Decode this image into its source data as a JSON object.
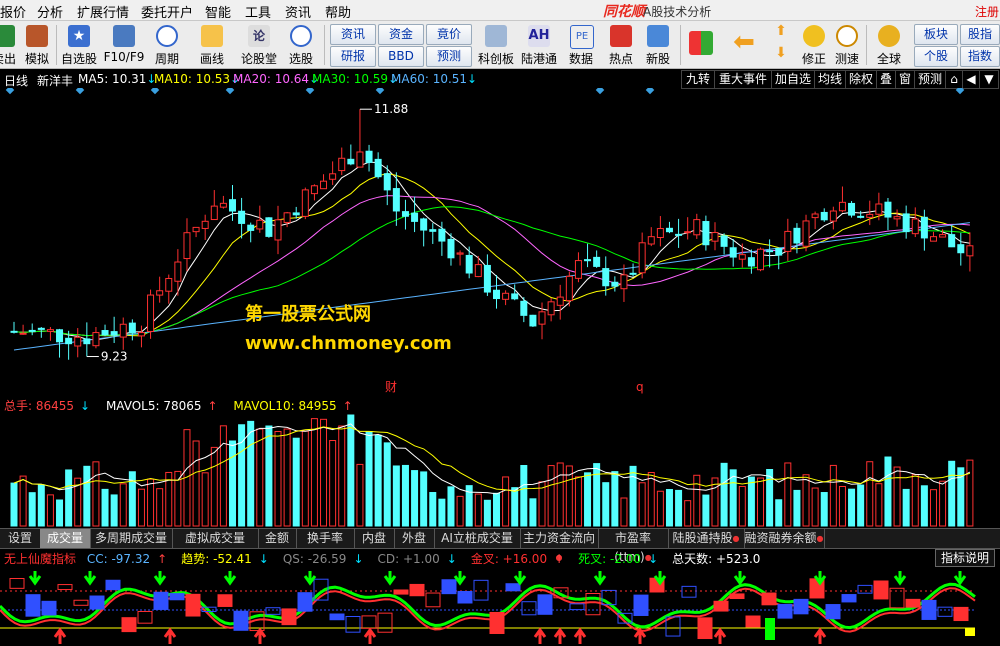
{
  "menu": {
    "items": [
      "报价",
      "分析",
      "扩展行情",
      "委托开户",
      "智能",
      "工具",
      "资讯",
      "帮助"
    ],
    "brand": "同花顺",
    "title": "A股技术分析",
    "register": "注册"
  },
  "toolbar": {
    "buttons": [
      {
        "label": "卖出",
        "icon": "trade-icon"
      },
      {
        "label": "模拟",
        "icon": "hammer-icon"
      },
      {
        "label": "自选股",
        "icon": "star-icon"
      },
      {
        "label": "F10/F9",
        "icon": "document-icon"
      },
      {
        "label": "周期",
        "icon": "clock-icon"
      },
      {
        "label": "画线",
        "icon": "pencil-icon"
      },
      {
        "label": "论股堂",
        "icon": "discuss-icon"
      },
      {
        "label": "选股",
        "icon": "search-icon"
      },
      {
        "label": "科创板",
        "icon": "board-icon"
      },
      {
        "label": "陆港通",
        "icon": "ah-icon"
      },
      {
        "label": "数据",
        "icon": "pe-icon"
      },
      {
        "label": "热点",
        "icon": "hot-icon"
      },
      {
        "label": "新股",
        "icon": "ipo-icon"
      },
      {
        "label": "修正",
        "icon": "gold-icon"
      },
      {
        "label": "测速",
        "icon": "timer-icon"
      },
      {
        "label": "全球",
        "icon": "globe-icon"
      }
    ],
    "ah_text": "AH",
    "pe_text": "PE",
    "small_buttons": [
      "资讯",
      "资金",
      "竟价",
      "研报",
      "BBD",
      "预测",
      "板块",
      "股指",
      "个股",
      "指数"
    ]
  },
  "chart": {
    "period": "日线",
    "stock_name": "新洋丰",
    "ma_items": [
      {
        "text": "MA5: 10.31",
        "arrow": "↓",
        "color": "#ffffff"
      },
      {
        "text": "MA10: 10.53",
        "arrow": "↓",
        "color": "#ffff00"
      },
      {
        "text": "MA20: 10.64",
        "arrow": "↓",
        "color": "#ff66ff"
      },
      {
        "text": "MA30: 10.59",
        "arrow": "↓",
        "color": "#00ff00"
      },
      {
        "text": "MA60: 10.51",
        "arrow": "↓",
        "color": "#5ab4ff"
      }
    ],
    "right_buttons": [
      "九转",
      "重大事件",
      "加自选",
      "均线",
      "除权",
      "叠",
      "窗",
      "预测",
      "⌂",
      "◀",
      "▼"
    ],
    "high_label": "11.88",
    "low_label": "9.23",
    "markers": [
      "财",
      "q"
    ],
    "watermark_line1": "第一股票公式网",
    "watermark_line2": "www.chnmoney.com",
    "colors": {
      "up": "#ff3030",
      "down": "#54ffff",
      "ma5": "#ffffff",
      "ma10": "#ffff00",
      "ma20": "#ff66ff",
      "ma30": "#00ff00",
      "ma60": "#5ab4ff"
    }
  },
  "volume": {
    "label": "总手: 86455",
    "label_arrow": "↓",
    "mavol5": "MAVOL5: 78065",
    "mavol5_arrow": "↑",
    "mavol10": "MAVOL10: 84955",
    "mavol10_arrow": "↑"
  },
  "tabs": [
    {
      "label": "设置",
      "dot": false,
      "active": false
    },
    {
      "label": "成交量",
      "dot": false,
      "active": true
    },
    {
      "label": "多周期成交量",
      "dot": false,
      "active": false
    },
    {
      "label": "虚拟成交量",
      "dot": false,
      "active": false
    },
    {
      "label": "金额",
      "dot": false,
      "active": false
    },
    {
      "label": "换手率",
      "dot": false,
      "active": false
    },
    {
      "label": "内盘",
      "dot": false,
      "active": false
    },
    {
      "label": "外盘",
      "dot": false,
      "active": false
    },
    {
      "label": "AI立桩成交量",
      "dot": false,
      "active": false
    },
    {
      "label": "主力资金流向",
      "dot": true,
      "active": false
    },
    {
      "label": "市盈率(ttm)",
      "dot": true,
      "active": false
    },
    {
      "label": "陆股通持股",
      "dot": true,
      "active": false
    },
    {
      "label": "融资融券余额",
      "dot": true,
      "active": false
    }
  ],
  "indicator": {
    "name": "无上仙魔指标",
    "items": [
      {
        "text": "CC: -97.32",
        "arrow": "↑",
        "color": "#5ab4ff"
      },
      {
        "text": "趋势: -52.41",
        "arrow": "↓",
        "color": "#ffff00"
      },
      {
        "text": "QS: -26.59",
        "arrow": "↓",
        "color": "#888888"
      },
      {
        "text": "CD: +1.00",
        "arrow": "↓",
        "color": "#888888"
      },
      {
        "text": "金叉: +16.00",
        "arrow": "↑",
        "color": "#ff3030"
      },
      {
        "text": "死叉: -2.00",
        "arrow": "↓",
        "color": "#00ff00"
      },
      {
        "text": "总天数: +523.0",
        "arrow": "",
        "color": "#ffffff"
      }
    ],
    "help": "指标说明"
  }
}
